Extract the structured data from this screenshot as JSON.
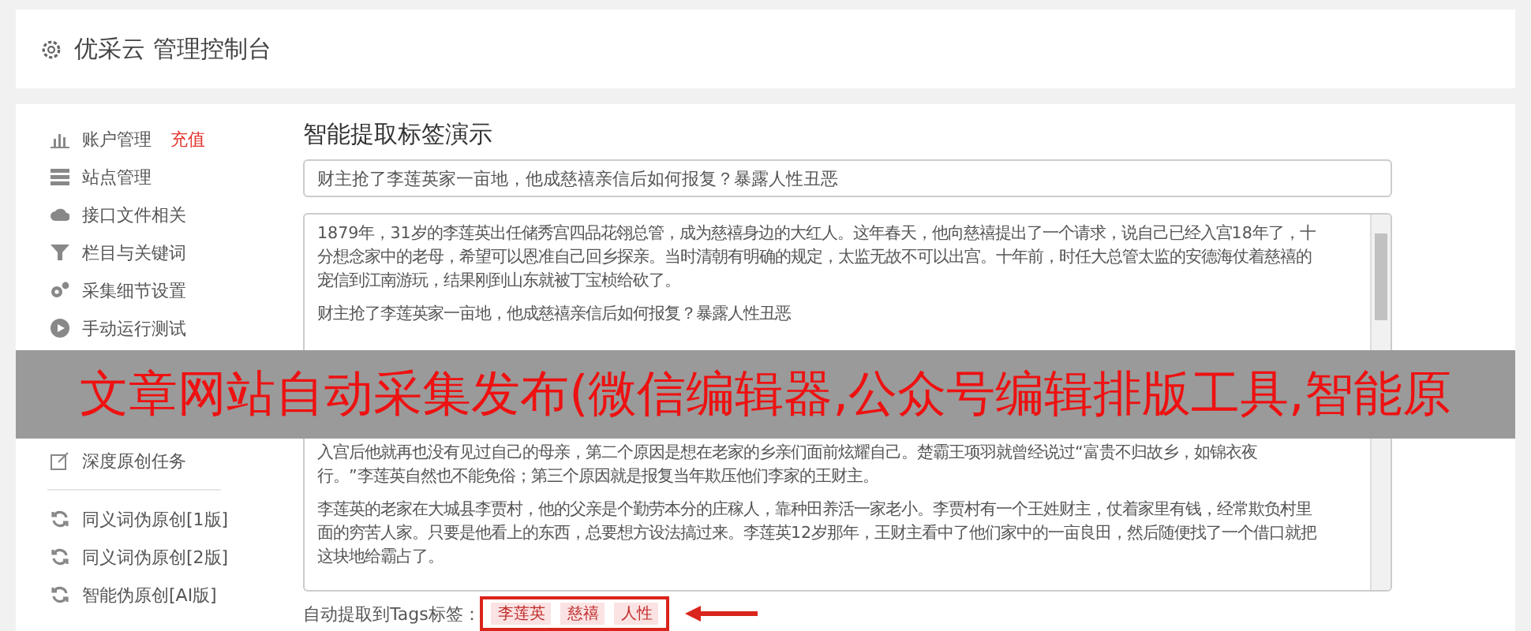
{
  "header": {
    "title": "优采云 管理控制台"
  },
  "sidebar": {
    "above": [
      {
        "label": "账户管理",
        "badge": "充值"
      },
      {
        "label": "站点管理"
      },
      {
        "label": "接口文件相关"
      },
      {
        "label": "栏目与关键词"
      },
      {
        "label": "采集细节设置"
      },
      {
        "label": "手动运行测试"
      }
    ],
    "below": [
      {
        "label": "深度原创任务"
      }
    ],
    "tools": [
      {
        "label": "同义词伪原创[1版]"
      },
      {
        "label": "同义词伪原创[2版]"
      },
      {
        "label": "智能伪原创[AI版]"
      }
    ]
  },
  "main": {
    "heading": "智能提取标签演示",
    "title_field": "财主抢了李莲英家一亩地，他成慈禧亲信后如何报复？暴露人性丑恶",
    "content_above": [
      [
        "1879年，31岁的李莲英出任储秀宫四品花翎总管，成为慈禧身边的大红人。这年春天，他向慈禧提出了一个请求，说自己已经入宫18年了，十",
        "分想念家中的老母，希望可以恩准自己回乡探亲。当时清朝有明确的规定，太监无故不可以出宫。十年前，时任大总管太监的安德海仗着慈禧的",
        "宠信到江南游玩，结果刚到山东就被丁宝桢给砍了。"
      ],
      [
        "财主抢了李莲英家一亩地，他成慈禧亲信后如何报复？暴露人性丑恶"
      ]
    ],
    "content_below": [
      [
        "入宫后他就再也没有见过自己的母亲，第二个原因是想在老家的乡亲们面前炫耀自己。楚霸王项羽就曾经说过“富贵不归故乡，如锦衣夜",
        "行。”李莲英自然也不能免俗；第三个原因就是报复当年欺压他们李家的王财主。"
      ],
      [
        "李莲英的老家在大城县李贾村，他的父亲是个勤劳本分的庄稼人，靠种田养活一家老小。李贾村有一个王姓财主，仗着家里有钱，经常欺负村里",
        "面的穷苦人家。只要是他看上的东西，总要想方设法搞过来。李莲英12岁那年，王财主看中了他们家中的一亩良田，然后随便找了一个借口就把",
        "这块地给霸占了。"
      ]
    ],
    "tags_label": "自动提取到Tags标签：",
    "tags": [
      "李莲英",
      "慈禧",
      "人性"
    ]
  },
  "banner": "文章网站自动采集发布(微信编辑器,公众号编辑排版工具,智能原"
}
